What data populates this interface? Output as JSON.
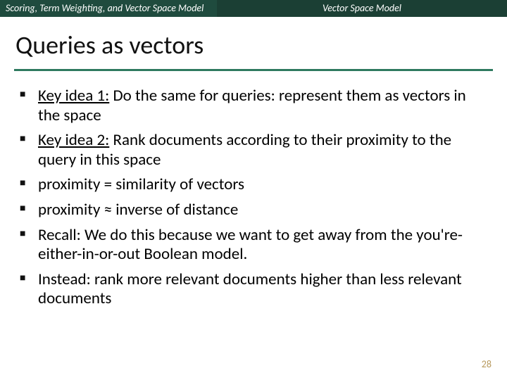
{
  "header": {
    "left": "Scoring, Term Weighting, and Vector Space Model",
    "right": "Vector Space Model"
  },
  "title": "Queries as vectors",
  "bullets": [
    {
      "lead": "Key idea 1:",
      "rest": " Do the same for queries: represent them as vectors in the space"
    },
    {
      "lead": "Key idea 2:",
      "rest": " Rank documents according to their proximity to the query in this space"
    },
    {
      "lead": "",
      "rest": "proximity = similarity of vectors"
    },
    {
      "lead": "",
      "rest": "proximity ≈ inverse of distance"
    },
    {
      "lead": "",
      "rest": "Recall: We do this because we want to get away from the you're-either-in-or-out Boolean model."
    },
    {
      "lead": "",
      "rest": "Instead: rank more relevant documents higher than less relevant documents"
    }
  ],
  "page_number": "28"
}
